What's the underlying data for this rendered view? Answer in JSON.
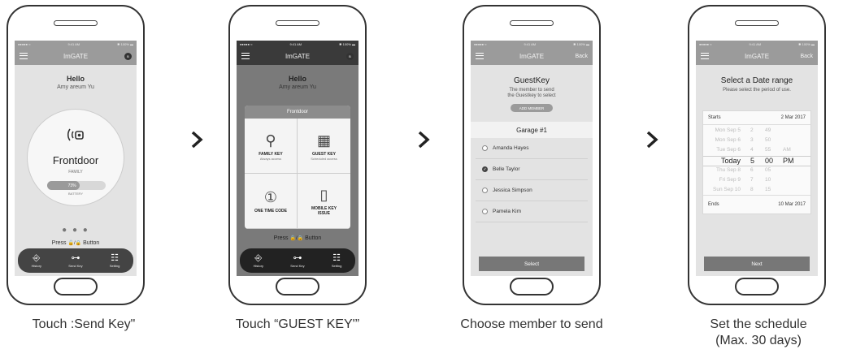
{
  "steps": [
    {
      "caption": "Touch :Send Key\""
    },
    {
      "caption": "Touch “GUEST KEY'”"
    },
    {
      "caption": "Choose member to send"
    },
    {
      "caption": "Set the schedule",
      "caption2": "(Max. 30 days)"
    }
  ],
  "status": {
    "carrier": "●●●●● ≈",
    "time": "9:41 AM",
    "battery": "✱ 100% ▬"
  },
  "screen1": {
    "app_title": "ImGATE",
    "badge": "B",
    "hello": "Hello",
    "user": "Amy areum Yu",
    "door_name": "Frontdoor",
    "door_type": "FAMILY",
    "battery_value": "73%",
    "battery_label": "BATTERY",
    "page_dots": "● ● ●",
    "press_left": "Press",
    "press_icon": "🔓/🔒",
    "press_right": "Button",
    "tabs": [
      "History",
      "Send Key",
      "Setting"
    ]
  },
  "screen2": {
    "app_title": "ImGATE",
    "badge": "B",
    "hello": "Hello",
    "user": "Amy areum Yu",
    "popup_title": "Frontdoor",
    "options": [
      {
        "label": "FAMILY KEY",
        "sub": "Always access"
      },
      {
        "label": "GUEST KEY",
        "sub": "Scheduled access"
      },
      {
        "label": "ONE TIME CODE",
        "sub": ""
      },
      {
        "label": "MOBILE KEY ISSUE",
        "sub": ""
      }
    ],
    "press_left": "Press",
    "press_right": "Button",
    "tabs": [
      "History",
      "Send Key",
      "Setting"
    ]
  },
  "screen3": {
    "app_title": "ImGATE",
    "back": "Back",
    "title": "GuestKey",
    "desc1": "The member to send",
    "desc2": "the Guestkey to select",
    "add_member": "ADD MEMBER",
    "group": "Garage #1",
    "members": [
      "Amanda Hayes",
      "Belle Taylor",
      "Jessica Simpson",
      "Pamela Kim"
    ],
    "selected_index": 1,
    "select_button": "Select"
  },
  "screen4": {
    "app_title": "ImGATE",
    "back": "Back",
    "title": "Select a Date range",
    "desc": "Please select the period of use.",
    "starts_label": "Starts",
    "starts_value": "2 Mar 2017",
    "picker_rows": [
      [
        "Mon Sep 5",
        "2",
        "49",
        ""
      ],
      [
        "Mon Sep 6",
        "3",
        "50",
        ""
      ],
      [
        "Tue Sep 6",
        "4",
        "55",
        "AM"
      ],
      [
        "Today",
        "5",
        "00",
        "PM"
      ],
      [
        "Thu Sep 8",
        "6",
        "05",
        ""
      ],
      [
        "Fri Sep 9",
        "7",
        "10",
        ""
      ],
      [
        "Sun Sep 10",
        "8",
        "15",
        ""
      ]
    ],
    "ends_label": "Ends",
    "ends_value": "10 Mar 2017",
    "next_button": "Next"
  }
}
